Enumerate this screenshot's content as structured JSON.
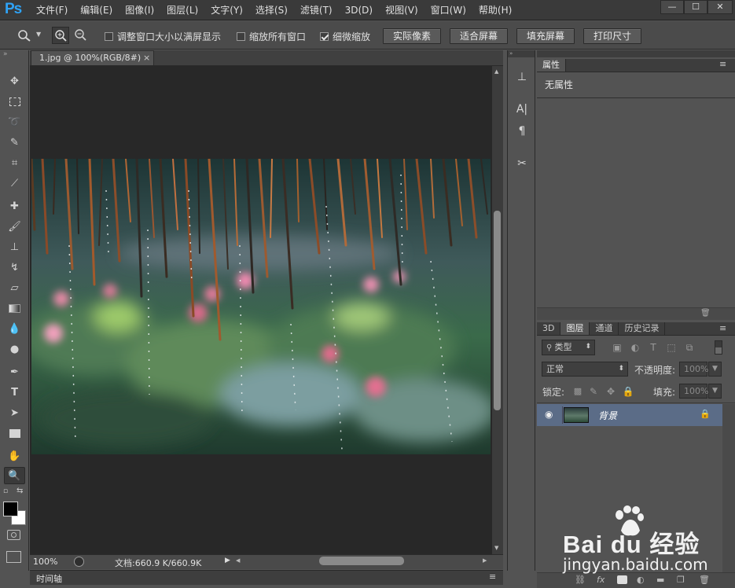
{
  "app": {
    "logo": "Ps"
  },
  "menu": [
    "文件(F)",
    "编辑(E)",
    "图像(I)",
    "图层(L)",
    "文字(Y)",
    "选择(S)",
    "滤镜(T)",
    "3D(D)",
    "视图(V)",
    "窗口(W)",
    "帮助(H)"
  ],
  "window_controls": {
    "minimize": "—",
    "maximize": "☐",
    "close": "✕"
  },
  "options": {
    "resize_windows": {
      "label": "调整窗口大小以满屏显示",
      "checked": false
    },
    "zoom_all": {
      "label": "缩放所有窗口",
      "checked": false
    },
    "scrubby_zoom": {
      "label": "细微缩放",
      "checked": true
    },
    "buttons": [
      "实际像素",
      "适合屏幕",
      "填充屏幕",
      "打印尺寸"
    ]
  },
  "document": {
    "tab": "1.jpg @ 100%(RGB/8#)",
    "close": "×"
  },
  "status": {
    "zoom": "100%",
    "doc_size": "文档:660.9 K/660.9K"
  },
  "timeline": {
    "label": "时间轴"
  },
  "properties_panel": {
    "tab": "属性",
    "content": "无属性"
  },
  "layers_panel": {
    "tabs": [
      "3D",
      "图层",
      "通道",
      "历史记录"
    ],
    "active_tab": "图层",
    "filter_kind": "类型",
    "blend_mode": "正常",
    "opacity_label": "不透明度:",
    "opacity": "100%",
    "lock_label": "锁定:",
    "fill_label": "填充:",
    "fill": "100%",
    "layers": [
      {
        "name": "背景",
        "visible": true,
        "locked": true
      }
    ]
  },
  "watermark": {
    "brand": "Bai du 经验",
    "url": "jingyan.baidu.com"
  },
  "colors": {
    "accent": "#2fa3f7",
    "selected_layer": "#5b6c87",
    "canvas_bg": "#282828"
  }
}
